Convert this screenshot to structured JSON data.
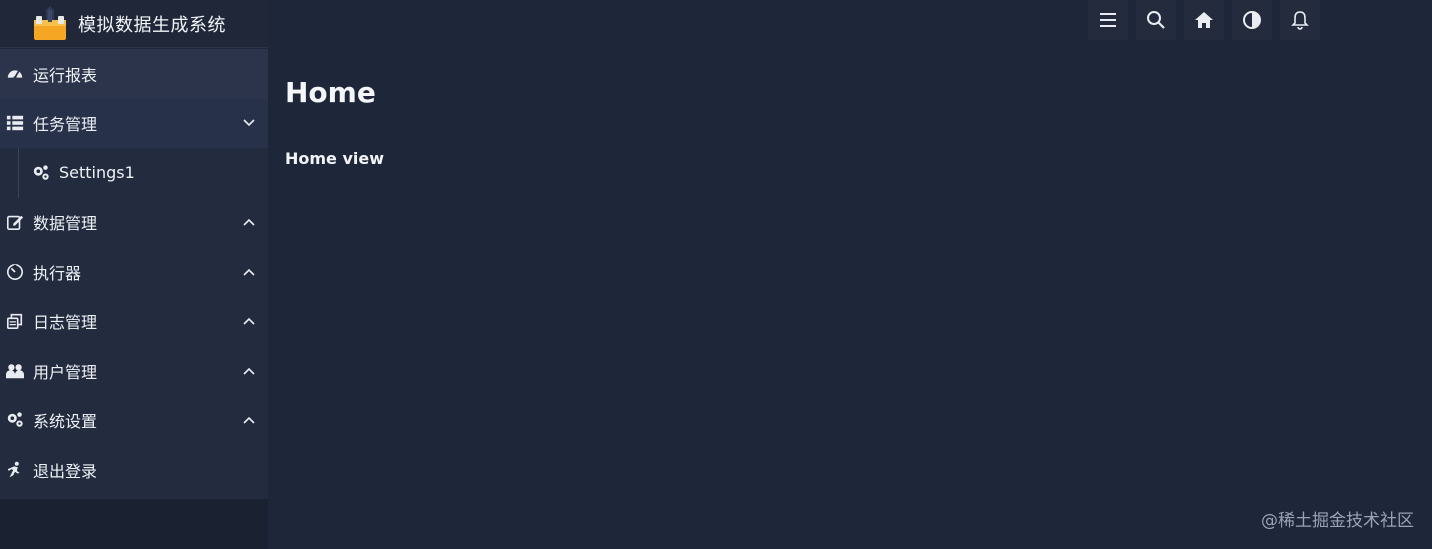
{
  "app": {
    "title": "模拟数据生成系统"
  },
  "sidebar": {
    "items": [
      {
        "label": "运行报表",
        "icon": "dashboard-icon",
        "expandable": false,
        "state": "active"
      },
      {
        "label": "任务管理",
        "icon": "list-icon",
        "expandable": true,
        "state": "open"
      },
      {
        "label": "Settings1",
        "icon": "gears-icon",
        "expandable": false,
        "state": "sub"
      },
      {
        "label": "数据管理",
        "icon": "edit-icon",
        "expandable": true,
        "state": "collapsed"
      },
      {
        "label": "执行器",
        "icon": "timer-icon",
        "expandable": true,
        "state": "collapsed"
      },
      {
        "label": "日志管理",
        "icon": "copy-icon",
        "expandable": true,
        "state": "collapsed"
      },
      {
        "label": "用户管理",
        "icon": "users-icon",
        "expandable": true,
        "state": "collapsed"
      },
      {
        "label": "系统设置",
        "icon": "gears-icon",
        "expandable": true,
        "state": "collapsed"
      },
      {
        "label": "退出登录",
        "icon": "running-icon",
        "expandable": false,
        "state": "normal"
      }
    ]
  },
  "toolbar": {
    "buttons": [
      {
        "icon": "menu-icon"
      },
      {
        "icon": "search-icon"
      },
      {
        "icon": "home-icon"
      },
      {
        "icon": "contrast-icon"
      },
      {
        "icon": "bell-icon"
      }
    ]
  },
  "main": {
    "title": "Home",
    "subtitle": "Home view"
  },
  "watermark": "@稀土掘金技术社区",
  "colors": {
    "background": "#1e2639",
    "sidebar": "#232b3e",
    "active": "#2b344a",
    "toolbar_button": "#232b3d",
    "text": "#eef1f6"
  }
}
